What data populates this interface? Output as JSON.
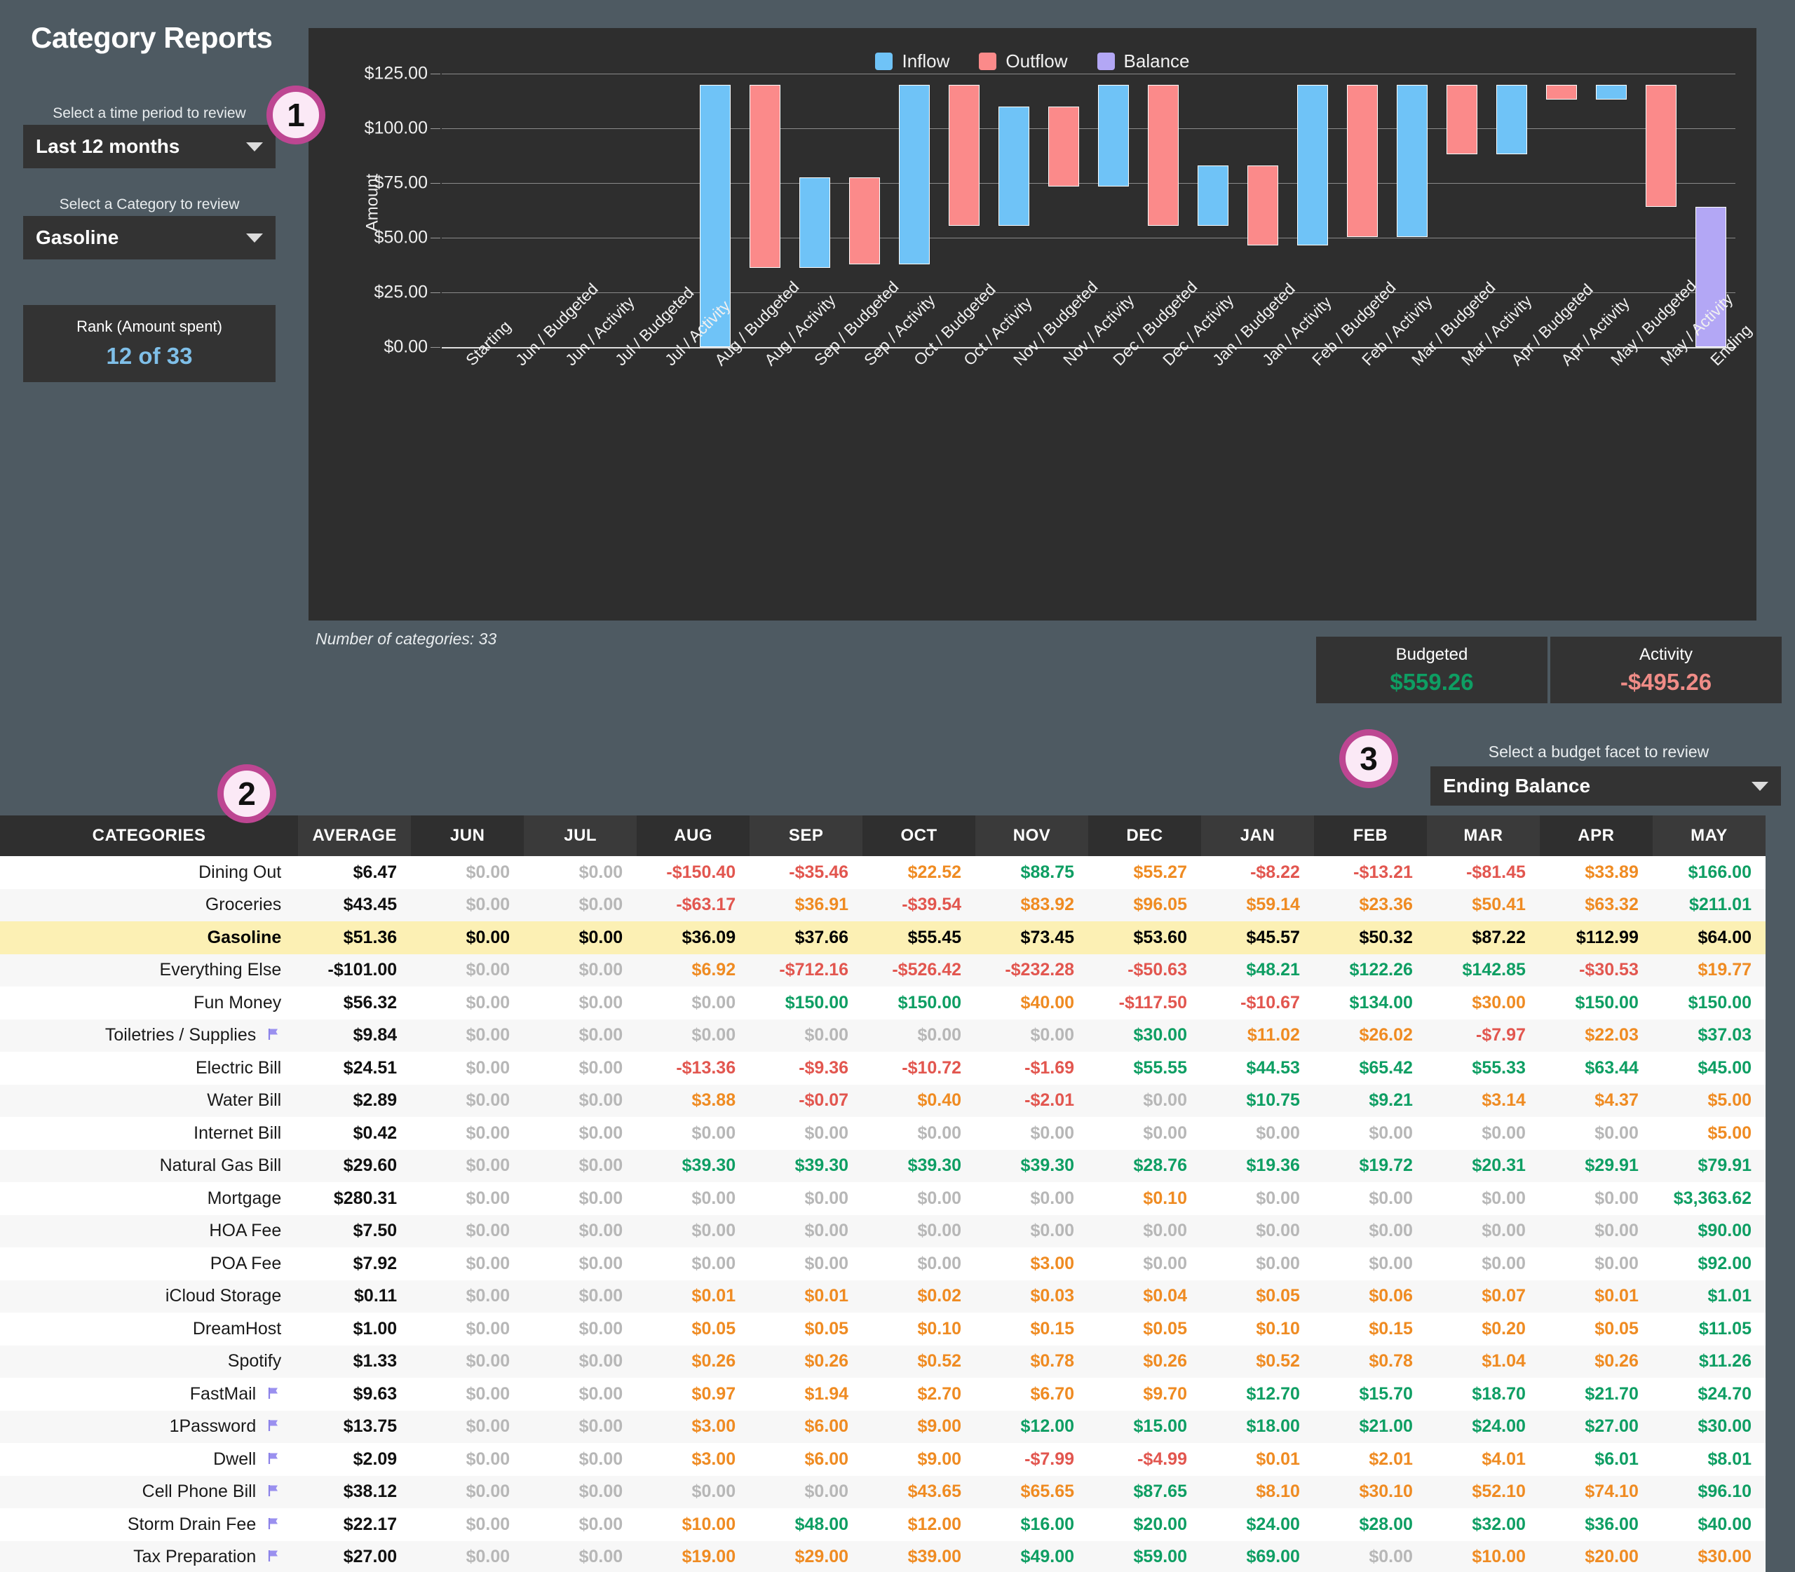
{
  "page": {
    "title": "Category Reports"
  },
  "controls": {
    "time_period_label": "Select a time period to review",
    "time_period_value": "Last 12 months",
    "category_label": "Select a Category to review",
    "category_value": "Gasoline",
    "rank_title": "Rank (Amount spent)",
    "rank_value": "12 of 33",
    "facet_label": "Select a budget facet to review",
    "facet_value": "Ending Balance"
  },
  "badges": {
    "one": "1",
    "two": "2",
    "three": "3"
  },
  "chart_footer": {
    "num_categories": "Number of categories: 33",
    "budgeted_title": "Budgeted",
    "budgeted_value": "$559.26",
    "activity_title": "Activity",
    "activity_value": "-$495.26"
  },
  "colors": {
    "inflow": "#6fc3f7",
    "outflow": "#fb8a8a",
    "balance": "#b3a7f5",
    "green": "#0e9e63",
    "red": "#e2564f",
    "orange": "#ef8b22",
    "zero_gray": "#b7b7b7",
    "accent_badge": "#bd4692",
    "highlight_row": "#fcf0b4",
    "rank_blue": "#7fbfe8"
  },
  "chart_data": {
    "type": "bar",
    "title": "",
    "xlabel": "",
    "ylabel": "Amount",
    "ylim": [
      0,
      125
    ],
    "yticks": [
      "$0.00",
      "$25.00",
      "$50.00",
      "$75.00",
      "$100.00",
      "$125.00"
    ],
    "ytick_values": [
      0,
      25,
      50,
      75,
      100,
      125
    ],
    "grid": true,
    "legend_position": "top-center",
    "legend": [
      {
        "name": "Inflow",
        "color": "#6fc3f7"
      },
      {
        "name": "Outflow",
        "color": "#fb8a8a"
      },
      {
        "name": "Balance",
        "color": "#b3a7f5"
      }
    ],
    "categories": [
      "Starting",
      "Jun / Budgeted",
      "Jun / Activity",
      "Jul / Budgeted",
      "Jul / Activity",
      "Aug / Budgeted",
      "Aug / Activity",
      "Sep / Budgeted",
      "Sep / Activity",
      "Oct / Budgeted",
      "Oct / Activity",
      "Nov / Budgeted",
      "Nov / Activity",
      "Dec / Budgeted",
      "Dec / Activity",
      "Jan / Budgeted",
      "Jan / Activity",
      "Feb / Budgeted",
      "Feb / Activity",
      "Mar / Budgeted",
      "Mar / Activity",
      "Apr / Budgeted",
      "Apr / Activity",
      "May / Budgeted",
      "May / Activity",
      "Ending"
    ],
    "waterfall": [
      {
        "label": "Starting",
        "kind": "none",
        "base": 0,
        "top": 0
      },
      {
        "label": "Jun / Budgeted",
        "kind": "none",
        "base": 0,
        "top": 0
      },
      {
        "label": "Jun / Activity",
        "kind": "none",
        "base": 0,
        "top": 0
      },
      {
        "label": "Jul / Budgeted",
        "kind": "none",
        "base": 0,
        "top": 0
      },
      {
        "label": "Jul / Activity",
        "kind": "none",
        "base": 0,
        "top": 0
      },
      {
        "label": "Aug / Budgeted",
        "kind": "inflow",
        "base": 0,
        "top": 120.0
      },
      {
        "label": "Aug / Activity",
        "kind": "outflow",
        "base": 36.09,
        "top": 120.0
      },
      {
        "label": "Sep / Budgeted",
        "kind": "inflow",
        "base": 36.09,
        "top": 77.5
      },
      {
        "label": "Sep / Activity",
        "kind": "outflow",
        "base": 37.66,
        "top": 77.5
      },
      {
        "label": "Oct / Budgeted",
        "kind": "inflow",
        "base": 37.66,
        "top": 120.0
      },
      {
        "label": "Oct / Activity",
        "kind": "outflow",
        "base": 55.45,
        "top": 120.0
      },
      {
        "label": "Nov / Budgeted",
        "kind": "inflow",
        "base": 55.45,
        "top": 110.0
      },
      {
        "label": "Nov / Activity",
        "kind": "outflow",
        "base": 73.45,
        "top": 110.0
      },
      {
        "label": "Dec / Budgeted",
        "kind": "inflow",
        "base": 73.45,
        "top": 120.0
      },
      {
        "label": "Dec / Activity",
        "kind": "outflow",
        "base": 55.45,
        "top": 120.0
      },
      {
        "label": "Jan / Budgeted",
        "kind": "inflow",
        "base": 55.45,
        "top": 83.0
      },
      {
        "label": "Jan / Activity",
        "kind": "outflow",
        "base": 46.5,
        "top": 83.0
      },
      {
        "label": "Feb / Budgeted",
        "kind": "inflow",
        "base": 46.5,
        "top": 120.0
      },
      {
        "label": "Feb / Activity",
        "kind": "outflow",
        "base": 50.32,
        "top": 120.0
      },
      {
        "label": "Mar / Budgeted",
        "kind": "inflow",
        "base": 50.32,
        "top": 120.0
      },
      {
        "label": "Mar / Activity",
        "kind": "outflow",
        "base": 88.0,
        "top": 120.0
      },
      {
        "label": "Apr / Budgeted",
        "kind": "inflow",
        "base": 88.0,
        "top": 120.0
      },
      {
        "label": "Apr / Activity",
        "kind": "outflow",
        "base": 113.0,
        "top": 120.0
      },
      {
        "label": "May / Budgeted",
        "kind": "inflow",
        "base": 113.0,
        "top": 120.0
      },
      {
        "label": "May / Activity",
        "kind": "outflow",
        "base": 64.0,
        "top": 120.0
      },
      {
        "label": "Ending",
        "kind": "balance",
        "base": 0,
        "top": 64.0
      }
    ]
  },
  "table": {
    "headers": [
      "CATEGORIES",
      "AVERAGE",
      "JUN",
      "JUL",
      "AUG",
      "SEP",
      "OCT",
      "NOV",
      "DEC",
      "JAN",
      "FEB",
      "MAR",
      "APR",
      "MAY"
    ],
    "rows": [
      {
        "name": "Dining Out",
        "flag": false,
        "highlight": false,
        "cells": [
          "$6.47",
          "$0.00",
          "$0.00",
          "-$150.40",
          "-$35.46",
          "$22.52",
          "$88.75",
          "$55.27",
          "-$8.22",
          "-$13.21",
          "-$81.45",
          "$33.89",
          "$166.00"
        ],
        "styles": [
          "dark",
          "zero",
          "zero",
          "neg",
          "neg",
          "low",
          "high",
          "low",
          "neg",
          "neg",
          "neg",
          "low",
          "high"
        ]
      },
      {
        "name": "Groceries",
        "flag": false,
        "highlight": false,
        "cells": [
          "$43.45",
          "$0.00",
          "$0.00",
          "-$63.17",
          "$36.91",
          "-$39.54",
          "$83.92",
          "$96.05",
          "$59.14",
          "$23.36",
          "$50.41",
          "$63.32",
          "$211.01"
        ],
        "styles": [
          "dark",
          "zero",
          "zero",
          "neg",
          "low",
          "neg",
          "low",
          "low",
          "low",
          "low",
          "low",
          "low",
          "high"
        ]
      },
      {
        "name": "Gasoline",
        "flag": false,
        "highlight": true,
        "cells": [
          "$51.36",
          "$0.00",
          "$0.00",
          "$36.09",
          "$37.66",
          "$55.45",
          "$73.45",
          "$53.60",
          "$45.57",
          "$50.32",
          "$87.22",
          "$112.99",
          "$64.00"
        ],
        "styles": [
          "dark",
          "dark",
          "dark",
          "dark",
          "dark",
          "dark",
          "dark",
          "dark",
          "dark",
          "dark",
          "dark",
          "dark",
          "dark"
        ]
      },
      {
        "name": "Everything Else",
        "flag": false,
        "highlight": false,
        "cells": [
          "-$101.00",
          "$0.00",
          "$0.00",
          "$6.92",
          "-$712.16",
          "-$526.42",
          "-$232.28",
          "-$50.63",
          "$48.21",
          "$122.26",
          "$142.85",
          "-$30.53",
          "$19.77"
        ],
        "styles": [
          "dark",
          "zero",
          "zero",
          "low",
          "neg",
          "neg",
          "neg",
          "neg",
          "high",
          "high",
          "high",
          "neg",
          "low"
        ]
      },
      {
        "name": "Fun Money",
        "flag": false,
        "highlight": false,
        "cells": [
          "$56.32",
          "$0.00",
          "$0.00",
          "$0.00",
          "$150.00",
          "$150.00",
          "$40.00",
          "-$117.50",
          "-$10.67",
          "$134.00",
          "$30.00",
          "$150.00",
          "$150.00"
        ],
        "styles": [
          "dark",
          "zero",
          "zero",
          "zero",
          "high",
          "high",
          "low",
          "neg",
          "neg",
          "high",
          "low",
          "high",
          "high"
        ]
      },
      {
        "name": "Toiletries / Supplies",
        "flag": true,
        "highlight": false,
        "cells": [
          "$9.84",
          "$0.00",
          "$0.00",
          "$0.00",
          "$0.00",
          "$0.00",
          "$0.00",
          "$30.00",
          "$11.02",
          "$26.02",
          "-$7.97",
          "$22.03",
          "$37.03"
        ],
        "styles": [
          "dark",
          "zero",
          "zero",
          "zero",
          "zero",
          "zero",
          "zero",
          "high",
          "low",
          "low",
          "neg",
          "low",
          "high"
        ]
      },
      {
        "name": "Electric Bill",
        "flag": false,
        "highlight": false,
        "cells": [
          "$24.51",
          "$0.00",
          "$0.00",
          "-$13.36",
          "-$9.36",
          "-$10.72",
          "-$1.69",
          "$55.55",
          "$44.53",
          "$65.42",
          "$55.33",
          "$63.44",
          "$45.00"
        ],
        "styles": [
          "dark",
          "zero",
          "zero",
          "neg",
          "neg",
          "neg",
          "neg",
          "high",
          "high",
          "high",
          "high",
          "high",
          "high"
        ]
      },
      {
        "name": "Water Bill",
        "flag": false,
        "highlight": false,
        "cells": [
          "$2.89",
          "$0.00",
          "$0.00",
          "$3.88",
          "-$0.07",
          "$0.40",
          "-$2.01",
          "$0.00",
          "$10.75",
          "$9.21",
          "$3.14",
          "$4.37",
          "$5.00"
        ],
        "styles": [
          "dark",
          "zero",
          "zero",
          "low",
          "neg",
          "low",
          "neg",
          "zero",
          "high",
          "high",
          "low",
          "low",
          "low"
        ]
      },
      {
        "name": "Internet Bill",
        "flag": false,
        "highlight": false,
        "cells": [
          "$0.42",
          "$0.00",
          "$0.00",
          "$0.00",
          "$0.00",
          "$0.00",
          "$0.00",
          "$0.00",
          "$0.00",
          "$0.00",
          "$0.00",
          "$0.00",
          "$5.00"
        ],
        "styles": [
          "dark",
          "zero",
          "zero",
          "zero",
          "zero",
          "zero",
          "zero",
          "zero",
          "zero",
          "zero",
          "zero",
          "zero",
          "low"
        ]
      },
      {
        "name": "Natural Gas Bill",
        "flag": false,
        "highlight": false,
        "cells": [
          "$29.60",
          "$0.00",
          "$0.00",
          "$39.30",
          "$39.30",
          "$39.30",
          "$39.30",
          "$28.76",
          "$19.36",
          "$19.72",
          "$20.31",
          "$29.91",
          "$79.91"
        ],
        "styles": [
          "dark",
          "zero",
          "zero",
          "high",
          "high",
          "high",
          "high",
          "high",
          "high",
          "high",
          "high",
          "high",
          "high"
        ]
      },
      {
        "name": "Mortgage",
        "flag": false,
        "highlight": false,
        "cells": [
          "$280.31",
          "$0.00",
          "$0.00",
          "$0.00",
          "$0.00",
          "$0.00",
          "$0.00",
          "$0.10",
          "$0.00",
          "$0.00",
          "$0.00",
          "$0.00",
          "$3,363.62"
        ],
        "styles": [
          "dark",
          "zero",
          "zero",
          "zero",
          "zero",
          "zero",
          "zero",
          "low",
          "zero",
          "zero",
          "zero",
          "zero",
          "high"
        ]
      },
      {
        "name": "HOA Fee",
        "flag": false,
        "highlight": false,
        "cells": [
          "$7.50",
          "$0.00",
          "$0.00",
          "$0.00",
          "$0.00",
          "$0.00",
          "$0.00",
          "$0.00",
          "$0.00",
          "$0.00",
          "$0.00",
          "$0.00",
          "$90.00"
        ],
        "styles": [
          "dark",
          "zero",
          "zero",
          "zero",
          "zero",
          "zero",
          "zero",
          "zero",
          "zero",
          "zero",
          "zero",
          "zero",
          "high"
        ]
      },
      {
        "name": "POA Fee",
        "flag": false,
        "highlight": false,
        "cells": [
          "$7.92",
          "$0.00",
          "$0.00",
          "$0.00",
          "$0.00",
          "$0.00",
          "$3.00",
          "$0.00",
          "$0.00",
          "$0.00",
          "$0.00",
          "$0.00",
          "$92.00"
        ],
        "styles": [
          "dark",
          "zero",
          "zero",
          "zero",
          "zero",
          "zero",
          "low",
          "zero",
          "zero",
          "zero",
          "zero",
          "zero",
          "high"
        ]
      },
      {
        "name": "iCloud Storage",
        "flag": false,
        "highlight": false,
        "cells": [
          "$0.11",
          "$0.00",
          "$0.00",
          "$0.01",
          "$0.01",
          "$0.02",
          "$0.03",
          "$0.04",
          "$0.05",
          "$0.06",
          "$0.07",
          "$0.01",
          "$1.01"
        ],
        "styles": [
          "dark",
          "zero",
          "zero",
          "low",
          "low",
          "low",
          "low",
          "low",
          "low",
          "low",
          "low",
          "low",
          "high"
        ]
      },
      {
        "name": "DreamHost",
        "flag": false,
        "highlight": false,
        "cells": [
          "$1.00",
          "$0.00",
          "$0.00",
          "$0.05",
          "$0.05",
          "$0.10",
          "$0.15",
          "$0.05",
          "$0.10",
          "$0.15",
          "$0.20",
          "$0.05",
          "$11.05"
        ],
        "styles": [
          "dark",
          "zero",
          "zero",
          "low",
          "low",
          "low",
          "low",
          "low",
          "low",
          "low",
          "low",
          "low",
          "high"
        ]
      },
      {
        "name": "Spotify",
        "flag": false,
        "highlight": false,
        "cells": [
          "$1.33",
          "$0.00",
          "$0.00",
          "$0.26",
          "$0.26",
          "$0.52",
          "$0.78",
          "$0.26",
          "$0.52",
          "$0.78",
          "$1.04",
          "$0.26",
          "$11.26"
        ],
        "styles": [
          "dark",
          "zero",
          "zero",
          "low",
          "low",
          "low",
          "low",
          "low",
          "low",
          "low",
          "low",
          "low",
          "high"
        ]
      },
      {
        "name": "FastMail",
        "flag": true,
        "highlight": false,
        "cells": [
          "$9.63",
          "$0.00",
          "$0.00",
          "$0.97",
          "$1.94",
          "$2.70",
          "$6.70",
          "$9.70",
          "$12.70",
          "$15.70",
          "$18.70",
          "$21.70",
          "$24.70"
        ],
        "styles": [
          "dark",
          "zero",
          "zero",
          "low",
          "low",
          "low",
          "low",
          "low",
          "high",
          "high",
          "high",
          "high",
          "high"
        ]
      },
      {
        "name": "1Password",
        "flag": true,
        "highlight": false,
        "cells": [
          "$13.75",
          "$0.00",
          "$0.00",
          "$3.00",
          "$6.00",
          "$9.00",
          "$12.00",
          "$15.00",
          "$18.00",
          "$21.00",
          "$24.00",
          "$27.00",
          "$30.00"
        ],
        "styles": [
          "dark",
          "zero",
          "zero",
          "low",
          "low",
          "low",
          "high",
          "high",
          "high",
          "high",
          "high",
          "high",
          "high"
        ]
      },
      {
        "name": "Dwell",
        "flag": true,
        "highlight": false,
        "cells": [
          "$2.09",
          "$0.00",
          "$0.00",
          "$3.00",
          "$6.00",
          "$9.00",
          "-$7.99",
          "-$4.99",
          "$0.01",
          "$2.01",
          "$4.01",
          "$6.01",
          "$8.01"
        ],
        "styles": [
          "dark",
          "zero",
          "zero",
          "low",
          "low",
          "low",
          "neg",
          "neg",
          "low",
          "low",
          "low",
          "high",
          "high"
        ]
      },
      {
        "name": "Cell Phone Bill",
        "flag": true,
        "highlight": false,
        "cells": [
          "$38.12",
          "$0.00",
          "$0.00",
          "$0.00",
          "$0.00",
          "$43.65",
          "$65.65",
          "$87.65",
          "$8.10",
          "$30.10",
          "$52.10",
          "$74.10",
          "$96.10"
        ],
        "styles": [
          "dark",
          "zero",
          "zero",
          "zero",
          "zero",
          "low",
          "low",
          "high",
          "low",
          "low",
          "low",
          "low",
          "high"
        ]
      },
      {
        "name": "Storm Drain Fee",
        "flag": true,
        "highlight": false,
        "cells": [
          "$22.17",
          "$0.00",
          "$0.00",
          "$10.00",
          "$48.00",
          "$12.00",
          "$16.00",
          "$20.00",
          "$24.00",
          "$28.00",
          "$32.00",
          "$36.00",
          "$40.00"
        ],
        "styles": [
          "dark",
          "zero",
          "zero",
          "low",
          "high",
          "low",
          "high",
          "high",
          "high",
          "high",
          "high",
          "high",
          "high"
        ]
      },
      {
        "name": "Tax Preparation",
        "flag": true,
        "highlight": false,
        "cells": [
          "$27.00",
          "$0.00",
          "$0.00",
          "$19.00",
          "$29.00",
          "$39.00",
          "$49.00",
          "$59.00",
          "$69.00",
          "$0.00",
          "$10.00",
          "$20.00",
          "$30.00"
        ],
        "styles": [
          "dark",
          "zero",
          "zero",
          "low",
          "low",
          "low",
          "high",
          "high",
          "high",
          "zero",
          "low",
          "low",
          "low"
        ]
      }
    ]
  }
}
